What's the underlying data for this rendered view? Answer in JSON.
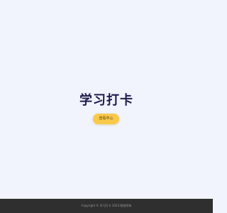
{
  "hero": {
    "title": "学习打卡",
    "button_label": "查看中心"
  },
  "footer": {
    "text": "Copyright © 学习打卡 2023 版权所有"
  },
  "colors": {
    "background": "#f1f4fc",
    "title": "#1f1c4b",
    "button": "#f8c94a",
    "footer_bg": "#2f2f2f",
    "footer_text": "#9a9a9a"
  }
}
